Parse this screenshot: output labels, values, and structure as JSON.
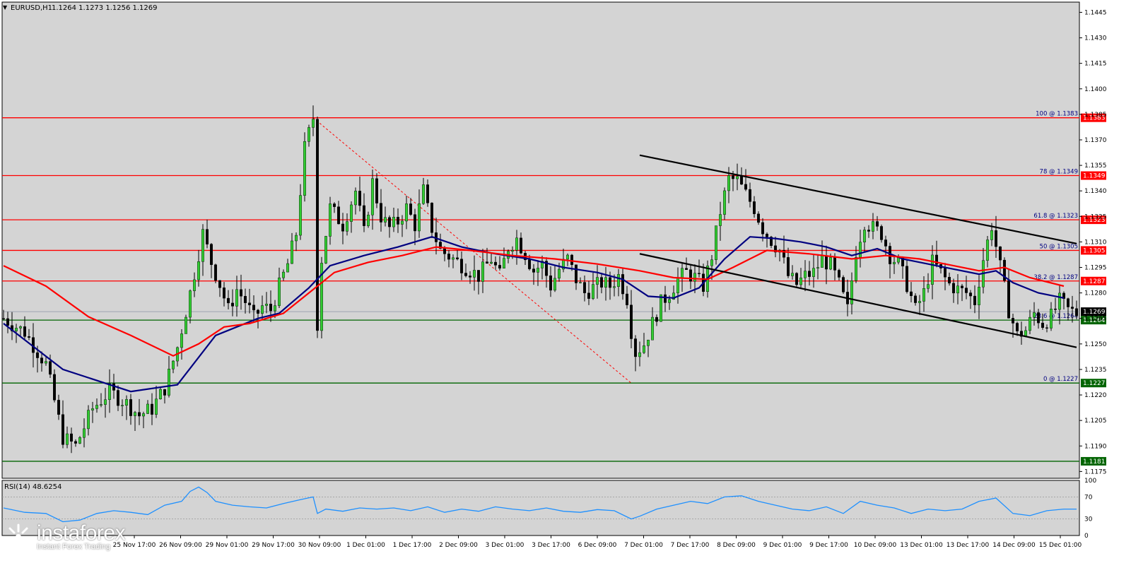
{
  "colors": {
    "chart_bg": "#d4d4d4",
    "frame": "#000000",
    "bull_candle": "#32cd32",
    "bear_candle": "#000000",
    "ma_fast": "#000080",
    "ma_slow": "#ff0000",
    "resistance_line": "#ff0000",
    "support_line": "#006400",
    "label_red": "#ff0000",
    "label_green": "#006400",
    "label_black": "#000000",
    "fibo": "#ff0000",
    "rsi_line": "#1e90ff",
    "trend_line": "#000000"
  },
  "header": {
    "symbol": "EURUSD,H1",
    "ohlc": "1.1264 1.1273 1.1256 1.1269"
  },
  "rsi_panel": {
    "title": "RSI(14) 48.6254",
    "levels": [
      100,
      70,
      30,
      0
    ]
  },
  "logo": {
    "name": "instaforex",
    "tagline": "Instant Forex Trading"
  },
  "chart_data": {
    "type": "candlestick",
    "symbol": "EURUSD",
    "timeframe": "H1",
    "ylim": [
      1.1171,
      1.1451
    ],
    "yticks": [
      "1.1445",
      "1.1430",
      "1.1415",
      "1.1400",
      "1.1385",
      "1.1370",
      "1.1355",
      "1.1340",
      "1.1325",
      "1.1310",
      "1.1295",
      "1.1280",
      "1.1265",
      "1.1250",
      "1.1235",
      "1.1220",
      "1.1205",
      "1.1190",
      "1.1175"
    ],
    "x_labels": [
      "25 Nov 17:00",
      "26 Nov 09:00",
      "29 Nov 01:00",
      "29 Nov 17:00",
      "30 Nov 09:00",
      "1 Dec 01:00",
      "1 Dec 17:00",
      "2 Dec 09:00",
      "3 Dec 01:00",
      "3 Dec 17:00",
      "6 Dec 09:00",
      "7 Dec 01:00",
      "7 Dec 17:00",
      "8 Dec 09:00",
      "9 Dec 01:00",
      "9 Dec 17:00",
      "10 Dec 09:00",
      "13 Dec 01:00",
      "13 Dec 17:00",
      "14 Dec 09:00",
      "15 Dec 01:00"
    ],
    "current_price": "1.1269",
    "current_price_value": 1.1269,
    "horizontal_levels": [
      {
        "value": 1.1383,
        "label": "1.1383",
        "fib_text": "100 @ 1.1383",
        "kind": "resistance"
      },
      {
        "value": 1.1349,
        "label": "1.1349",
        "fib_text": "78 @ 1.1349",
        "kind": "resistance"
      },
      {
        "value": 1.1323,
        "label": "1.1323",
        "fib_text": "61.8 @ 1.1323",
        "kind": "resistance"
      },
      {
        "value": 1.1305,
        "label": "1.1305",
        "fib_text": "50 @ 1.1305",
        "kind": "resistance"
      },
      {
        "value": 1.1287,
        "label": "1.1287",
        "fib_text": "38.2 @ 1.1287",
        "kind": "resistance"
      },
      {
        "value": 1.1264,
        "label": "1.1264",
        "fib_text": "23.6 @ 1.1264",
        "kind": "support"
      },
      {
        "value": 1.1227,
        "label": "1.1227",
        "fib_text": "0 @ 1.1227",
        "kind": "support"
      },
      {
        "value": 1.1181,
        "label": "1.1181",
        "fib_text": "",
        "kind": "support"
      }
    ],
    "fibonacci": {
      "high": 1.1383,
      "low": 1.1227
    },
    "price_path": [
      [
        0,
        1.1265
      ],
      [
        5,
        1.1257
      ],
      [
        10,
        1.1238
      ],
      [
        14,
        1.1195
      ],
      [
        17,
        1.119
      ],
      [
        21,
        1.1212
      ],
      [
        25,
        1.1222
      ],
      [
        29,
        1.1215
      ],
      [
        32,
        1.1208
      ],
      [
        35,
        1.1212
      ],
      [
        38,
        1.1224
      ],
      [
        41,
        1.1248
      ],
      [
        44,
        1.128
      ],
      [
        47,
        1.1315
      ],
      [
        49,
        1.1298
      ],
      [
        51,
        1.1285
      ],
      [
        53,
        1.127
      ],
      [
        55,
        1.1282
      ],
      [
        57,
        1.1275
      ],
      [
        59,
        1.1265
      ],
      [
        61,
        1.1272
      ],
      [
        63,
        1.127
      ],
      [
        65,
        1.1284
      ],
      [
        67,
        1.1297
      ],
      [
        69,
        1.1315
      ],
      [
        71,
        1.1365
      ],
      [
        73,
        1.1383
      ],
      [
        74,
        1.1262
      ],
      [
        75,
        1.13
      ],
      [
        77,
        1.133
      ],
      [
        80,
        1.132
      ],
      [
        83,
        1.134
      ],
      [
        85,
        1.1315
      ],
      [
        87,
        1.1345
      ],
      [
        89,
        1.1325
      ],
      [
        91,
        1.1318
      ],
      [
        93,
        1.1322
      ],
      [
        95,
        1.133
      ],
      [
        97,
        1.132
      ],
      [
        99,
        1.134
      ],
      [
        101,
        1.1318
      ],
      [
        103,
        1.1305
      ],
      [
        106,
        1.13
      ],
      [
        109,
        1.1295
      ],
      [
        112,
        1.129
      ],
      [
        115,
        1.13
      ],
      [
        117,
        1.129
      ],
      [
        119,
        1.1307
      ],
      [
        121,
        1.1312
      ],
      [
        123,
        1.1303
      ],
      [
        125,
        1.1293
      ],
      [
        127,
        1.1297
      ],
      [
        129,
        1.1284
      ],
      [
        131,
        1.1294
      ],
      [
        133,
        1.13
      ],
      [
        135,
        1.1288
      ],
      [
        137,
        1.128
      ],
      [
        139,
        1.1283
      ],
      [
        141,
        1.1286
      ],
      [
        143,
        1.1284
      ],
      [
        145,
        1.129
      ],
      [
        147,
        1.1277
      ],
      [
        148,
        1.1258
      ],
      [
        149,
        1.1245
      ],
      [
        151,
        1.125
      ],
      [
        153,
        1.1262
      ],
      [
        155,
        1.1274
      ],
      [
        157,
        1.128
      ],
      [
        159,
        1.1288
      ],
      [
        161,
        1.1292
      ],
      [
        163,
        1.1289
      ],
      [
        165,
        1.1284
      ],
      [
        167,
        1.1302
      ],
      [
        169,
        1.1328
      ],
      [
        171,
        1.1347
      ],
      [
        173,
        1.1346
      ],
      [
        175,
        1.1338
      ],
      [
        177,
        1.133
      ],
      [
        179,
        1.1318
      ],
      [
        181,
        1.1311
      ],
      [
        183,
        1.1305
      ],
      [
        185,
        1.129
      ],
      [
        187,
        1.1285
      ],
      [
        189,
        1.129
      ],
      [
        191,
        1.1292
      ],
      [
        193,
        1.13
      ],
      [
        195,
        1.1296
      ],
      [
        197,
        1.1285
      ],
      [
        199,
        1.127
      ],
      [
        201,
        1.1305
      ],
      [
        203,
        1.1322
      ],
      [
        205,
        1.1318
      ],
      [
        207,
        1.1315
      ],
      [
        209,
        1.1302
      ],
      [
        211,
        1.1297
      ],
      [
        213,
        1.1285
      ],
      [
        215,
        1.127
      ],
      [
        217,
        1.128
      ],
      [
        219,
        1.1298
      ],
      [
        221,
        1.1292
      ],
      [
        223,
        1.1285
      ],
      [
        225,
        1.1282
      ],
      [
        227,
        1.128
      ],
      [
        229,
        1.1275
      ],
      [
        231,
        1.13
      ],
      [
        233,
        1.132
      ],
      [
        235,
        1.1295
      ],
      [
        237,
        1.127
      ],
      [
        239,
        1.1255
      ],
      [
        241,
        1.1258
      ],
      [
        243,
        1.1268
      ],
      [
        245,
        1.1262
      ],
      [
        247,
        1.1266
      ],
      [
        249,
        1.1275
      ],
      [
        251,
        1.127
      ],
      [
        253,
        1.1268
      ]
    ],
    "series": [
      {
        "name": "",
        "type": "moving_average",
        "points": [
          [
            0,
            1.1262
          ],
          [
            14,
            1.1235
          ],
          [
            30,
            1.1222
          ],
          [
            41,
            1.1226
          ],
          [
            50,
            1.1255
          ],
          [
            60,
            1.1265
          ],
          [
            65,
            1.1268
          ],
          [
            72,
            1.1283
          ],
          [
            77,
            1.1296
          ],
          [
            85,
            1.1302
          ],
          [
            93,
            1.1307
          ],
          [
            101,
            1.1313
          ],
          [
            108,
            1.1307
          ],
          [
            116,
            1.1303
          ],
          [
            124,
            1.13
          ],
          [
            132,
            1.1295
          ],
          [
            140,
            1.1292
          ],
          [
            146,
            1.1288
          ],
          [
            152,
            1.1278
          ],
          [
            158,
            1.1277
          ],
          [
            164,
            1.1283
          ],
          [
            170,
            1.13
          ],
          [
            176,
            1.1313
          ],
          [
            182,
            1.1312
          ],
          [
            188,
            1.131
          ],
          [
            194,
            1.1307
          ],
          [
            200,
            1.1302
          ],
          [
            206,
            1.1306
          ],
          [
            212,
            1.13
          ],
          [
            218,
            1.1297
          ],
          [
            224,
            1.1294
          ],
          [
            230,
            1.1291
          ],
          [
            234,
            1.1293
          ],
          [
            238,
            1.1286
          ],
          [
            244,
            1.128
          ],
          [
            250,
            1.1277
          ]
        ]
      },
      {
        "name": "",
        "type": "moving_average",
        "points": [
          [
            0,
            1.1296
          ],
          [
            10,
            1.1284
          ],
          [
            20,
            1.1266
          ],
          [
            30,
            1.1255
          ],
          [
            40,
            1.1243
          ],
          [
            46,
            1.125
          ],
          [
            52,
            1.126
          ],
          [
            58,
            1.1262
          ],
          [
            66,
            1.1268
          ],
          [
            72,
            1.128
          ],
          [
            78,
            1.1292
          ],
          [
            86,
            1.1298
          ],
          [
            94,
            1.1302
          ],
          [
            102,
            1.1307
          ],
          [
            110,
            1.1305
          ],
          [
            120,
            1.1302
          ],
          [
            130,
            1.13
          ],
          [
            140,
            1.1297
          ],
          [
            150,
            1.1293
          ],
          [
            158,
            1.1289
          ],
          [
            166,
            1.1288
          ],
          [
            172,
            1.1295
          ],
          [
            180,
            1.1305
          ],
          [
            190,
            1.1303
          ],
          [
            200,
            1.13
          ],
          [
            208,
            1.1302
          ],
          [
            216,
            1.13
          ],
          [
            224,
            1.1296
          ],
          [
            230,
            1.1293
          ],
          [
            236,
            1.1295
          ],
          [
            242,
            1.1289
          ],
          [
            250,
            1.1284
          ]
        ]
      }
    ],
    "trend_lines": [
      {
        "from": [
          150,
          1.1361
        ],
        "to": [
          253,
          1.1309
        ]
      },
      {
        "from": [
          150,
          1.1303
        ],
        "to": [
          253,
          1.1248
        ]
      }
    ],
    "rsi": {
      "name": "RSI(14)",
      "value": 48.6254,
      "ylim": [
        0,
        100
      ],
      "points": [
        [
          0,
          50
        ],
        [
          5,
          42
        ],
        [
          10,
          40
        ],
        [
          14,
          25
        ],
        [
          18,
          28
        ],
        [
          22,
          40
        ],
        [
          26,
          45
        ],
        [
          30,
          42
        ],
        [
          34,
          38
        ],
        [
          38,
          55
        ],
        [
          42,
          62
        ],
        [
          44,
          80
        ],
        [
          46,
          88
        ],
        [
          48,
          78
        ],
        [
          50,
          62
        ],
        [
          54,
          55
        ],
        [
          58,
          52
        ],
        [
          62,
          50
        ],
        [
          66,
          58
        ],
        [
          70,
          65
        ],
        [
          73,
          70
        ],
        [
          74,
          40
        ],
        [
          76,
          48
        ],
        [
          80,
          44
        ],
        [
          84,
          50
        ],
        [
          88,
          48
        ],
        [
          92,
          50
        ],
        [
          96,
          45
        ],
        [
          100,
          52
        ],
        [
          104,
          42
        ],
        [
          108,
          48
        ],
        [
          112,
          44
        ],
        [
          116,
          52
        ],
        [
          120,
          48
        ],
        [
          124,
          45
        ],
        [
          128,
          50
        ],
        [
          132,
          44
        ],
        [
          136,
          42
        ],
        [
          140,
          47
        ],
        [
          144,
          45
        ],
        [
          148,
          30
        ],
        [
          150,
          35
        ],
        [
          154,
          48
        ],
        [
          158,
          55
        ],
        [
          162,
          62
        ],
        [
          166,
          58
        ],
        [
          170,
          70
        ],
        [
          174,
          72
        ],
        [
          178,
          62
        ],
        [
          182,
          55
        ],
        [
          186,
          48
        ],
        [
          190,
          45
        ],
        [
          194,
          52
        ],
        [
          198,
          40
        ],
        [
          202,
          62
        ],
        [
          206,
          55
        ],
        [
          210,
          50
        ],
        [
          214,
          40
        ],
        [
          218,
          48
        ],
        [
          222,
          45
        ],
        [
          226,
          48
        ],
        [
          230,
          62
        ],
        [
          234,
          68
        ],
        [
          238,
          40
        ],
        [
          242,
          36
        ],
        [
          246,
          45
        ],
        [
          250,
          48
        ],
        [
          253,
          48
        ]
      ]
    }
  }
}
